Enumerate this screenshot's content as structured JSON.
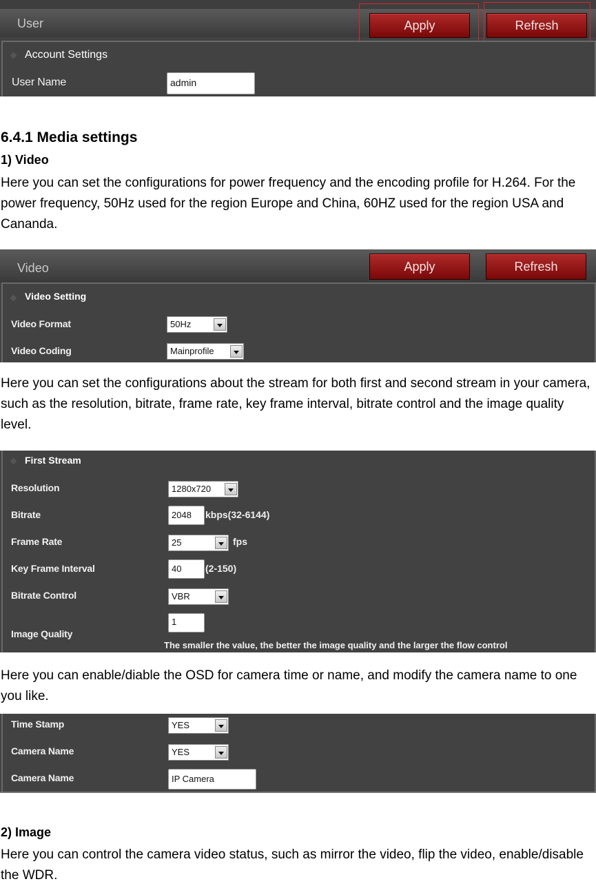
{
  "panel_user": {
    "title": "User",
    "apply_label": "Apply",
    "refresh_label": "Refresh",
    "group_title": "Account Settings",
    "user_name_label": "User Name",
    "user_name_value": "admin",
    "highlight_color": "#e0232f"
  },
  "doc": {
    "section_heading": "6.4.1 Media settings",
    "video_heading": "1) Video",
    "video_para": "Here you can set the configurations for power frequency and the encoding profile for H.264. For the power frequency, 50Hz used for the region Europe and China, 60HZ used for the region USA and Cananda.",
    "stream_para": "Here you can set the configurations about the stream for both first and second stream in your camera, such as the resolution, bitrate, frame rate, key frame interval, bitrate control and the image quality level.",
    "osd_para": "Here you can enable/diable the OSD for camera time or name, and modify the camera name to one you like.",
    "image_heading": "2) Image",
    "image_para": "Here you can control the camera video status, such as mirror the video, flip the video, enable/disable the WDR."
  },
  "panel_video": {
    "title": "Video",
    "apply_label": "Apply",
    "refresh_label": "Refresh",
    "group_title": "Video Setting",
    "video_format_label": "Video Format",
    "video_format_value": "50Hz",
    "video_coding_label": "Video Coding",
    "video_coding_value": "Mainprofile"
  },
  "panel_stream": {
    "group_title": "First Stream",
    "resolution_label": "Resolution",
    "resolution_value": "1280x720",
    "bitrate_label": "Bitrate",
    "bitrate_value": "2048",
    "bitrate_hint": "kbps(32-6144)",
    "frame_rate_label": "Frame Rate",
    "frame_rate_value": "25",
    "frame_rate_unit": "fps",
    "key_frame_label": "Key Frame Interval",
    "key_frame_value": "40",
    "key_frame_hint": "(2-150)",
    "bitrate_control_label": "Bitrate Control",
    "bitrate_control_value": "VBR",
    "image_quality_label": "Image Quality",
    "image_quality_value": "1",
    "image_quality_hint": "The smaller the value, the better the image quality and the larger the flow control"
  },
  "panel_osd": {
    "time_stamp_label": "Time Stamp",
    "time_stamp_value": "YES",
    "camera_name_toggle_label": "Camera Name",
    "camera_name_toggle_value": "YES",
    "camera_name_label": "Camera Name",
    "camera_name_value": "IP Camera"
  }
}
